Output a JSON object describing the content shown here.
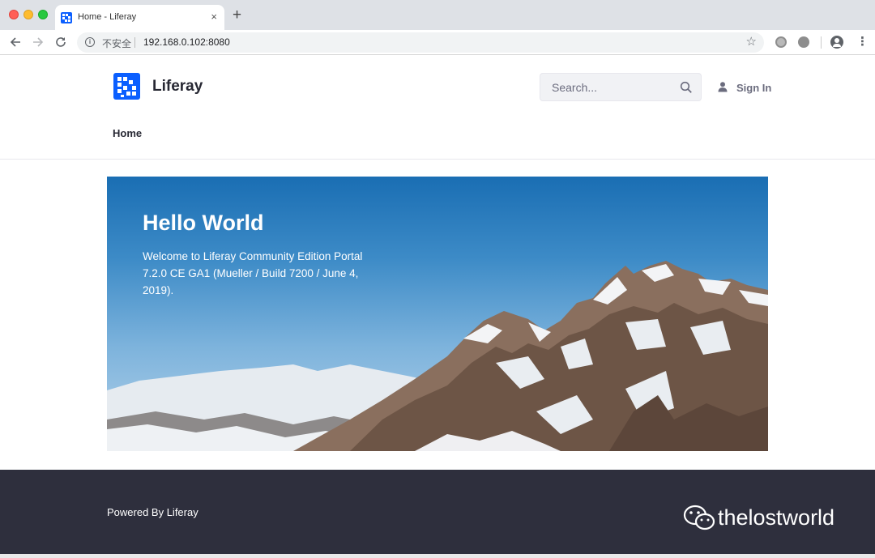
{
  "browser": {
    "tab_title": "Home - Liferay",
    "tab_close": "×",
    "new_tab": "+",
    "security_label": "不安全",
    "url": "192.168.0.102:8080"
  },
  "header": {
    "site_name": "Liferay",
    "search_placeholder": "Search...",
    "sign_in_label": "Sign In"
  },
  "nav": {
    "items": [
      {
        "label": "Home"
      }
    ]
  },
  "hero": {
    "title": "Hello World",
    "text": "Welcome to Liferay Community Edition Portal 7.2.0 CE GA1 (Mueller / Build 7200 / June 4, 2019)."
  },
  "footer": {
    "powered_by": "Powered By Liferay",
    "watermark": "thelostworld"
  },
  "colors": {
    "brand": "#0b5fff",
    "footer_bg": "#2e2f3d",
    "text_primary": "#272833",
    "text_secondary": "#6b6c7e"
  }
}
